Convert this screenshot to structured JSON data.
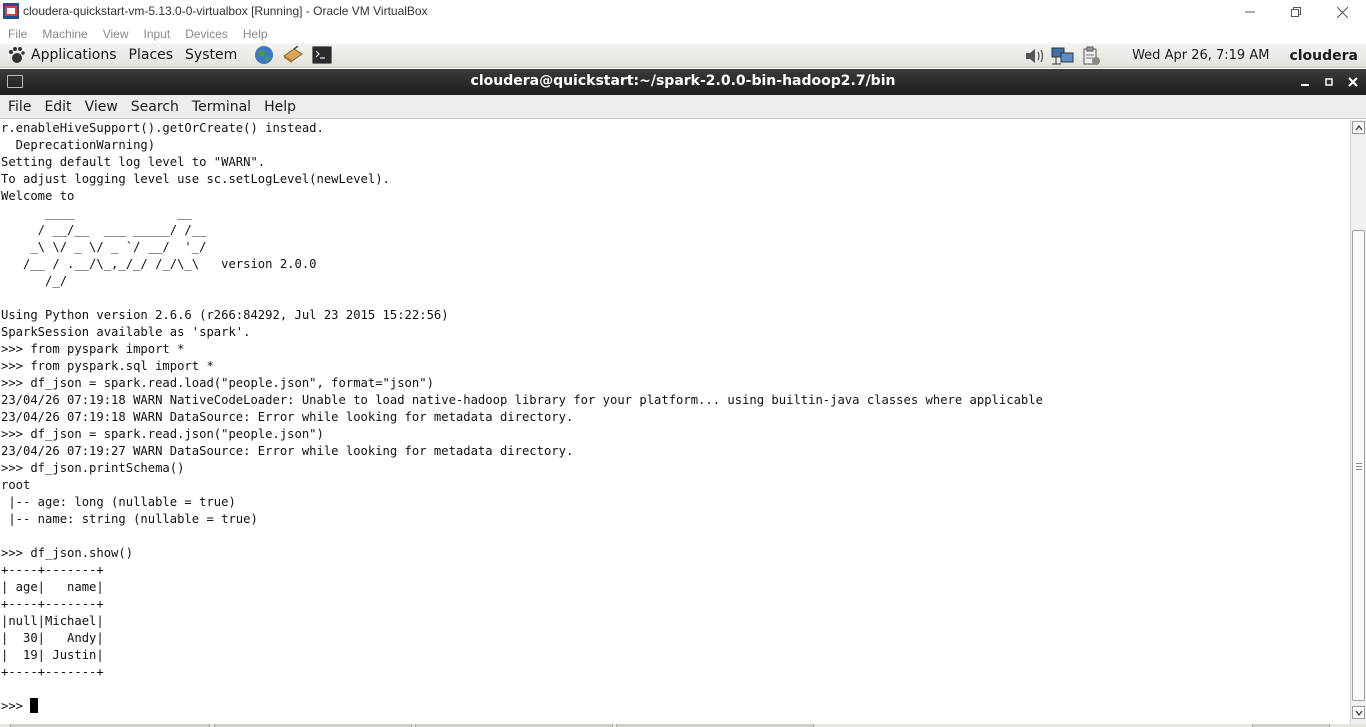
{
  "host_window": {
    "title": "cloudera-quickstart-vm-5.13.0-0-virtualbox [Running] - Oracle VM VirtualBox",
    "menu": [
      "File",
      "Machine",
      "View",
      "Input",
      "Devices",
      "Help"
    ]
  },
  "guest_panel": {
    "menus": [
      "Applications",
      "Places",
      "System"
    ],
    "launchers": [
      "globe-icon",
      "notes-icon",
      "terminal-icon"
    ],
    "tray_icons": [
      "speaker-icon",
      "network-icon",
      "clipboard-icon"
    ],
    "clock": "Wed Apr 26,  7:19 AM",
    "user": "cloudera"
  },
  "terminal": {
    "title": "cloudera@quickstart:~/spark-2.0.0-bin-hadoop2.7/bin",
    "menu": [
      "File",
      "Edit",
      "View",
      "Search",
      "Terminal",
      "Help"
    ],
    "lines": [
      "r.enableHiveSupport().getOrCreate() instead.",
      "  DeprecationWarning)",
      "Setting default log level to \"WARN\".",
      "To adjust logging level use sc.setLogLevel(newLevel).",
      "Welcome to",
      "      ____              __",
      "     / __/__  ___ _____/ /__",
      "    _\\ \\/ _ \\/ _ `/ __/  '_/",
      "   /__ / .__/\\_,_/_/ /_/\\_\\   version 2.0.0",
      "      /_/",
      "",
      "Using Python version 2.6.6 (r266:84292, Jul 23 2015 15:22:56)",
      "SparkSession available as 'spark'.",
      ">>> from pyspark import *",
      ">>> from pyspark.sql import *",
      ">>> df_json = spark.read.load(\"people.json\", format=\"json\")",
      "23/04/26 07:19:18 WARN NativeCodeLoader: Unable to load native-hadoop library for your platform... using builtin-java classes where applicable",
      "23/04/26 07:19:18 WARN DataSource: Error while looking for metadata directory.",
      ">>> df_json = spark.read.json(\"people.json\")",
      "23/04/26 07:19:27 WARN DataSource: Error while looking for metadata directory.",
      ">>> df_json.printSchema()",
      "root",
      " |-- age: long (nullable = true)",
      " |-- name: string (nullable = true)",
      "",
      ">>> df_json.show()",
      "+----+-------+",
      "| age|   name|",
      "+----+-------+",
      "|null|Michael|",
      "|  30|   Andy|",
      "|  19| Justin|",
      "+----+-------+",
      "",
      ">>> "
    ]
  }
}
